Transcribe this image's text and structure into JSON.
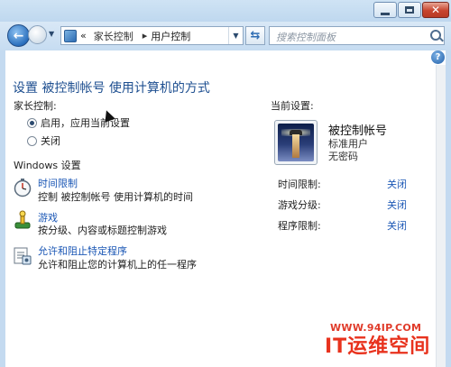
{
  "navigation": {
    "breadcrumb_prefix": "«",
    "breadcrumb": [
      "家长控制",
      "用户控制"
    ],
    "breadcrumb_separator": "▸",
    "search_placeholder": "搜索控制面板"
  },
  "help": {
    "label": "?"
  },
  "main": {
    "heading": "设置 被控制帐号 使用计算机的方式",
    "parental_controls_label": "家长控制:",
    "options": [
      {
        "label": "启用，应用当前设置",
        "selected": true
      },
      {
        "label": "关闭",
        "selected": false
      }
    ],
    "windows_settings_label": "Windows 设置",
    "settings": [
      {
        "icon": "stopwatch-icon",
        "link": "时间限制",
        "description": "控制 被控制帐号 使用计算机的时间"
      },
      {
        "icon": "game-controller-icon",
        "link": "游戏",
        "description": "按分级、内容或标题控制游戏"
      },
      {
        "icon": "program-list-icon",
        "link": "允许和阻止特定程序",
        "description": "允许和阻止您的计算机上的任一程序"
      }
    ]
  },
  "current_settings": {
    "label": "当前设置:",
    "user_name": "被控制帐号",
    "account_type": "标准用户",
    "password_status": "无密码",
    "items": [
      {
        "label": "时间限制:",
        "value": "关闭"
      },
      {
        "label": "游戏分级:",
        "value": "关闭"
      },
      {
        "label": "程序限制:",
        "value": "关闭"
      }
    ]
  },
  "watermark": {
    "url": "WWW.94IP.COM",
    "title": "IT运维空间"
  },
  "colors": {
    "link": "#1b57b5",
    "heading": "#1e4f90",
    "frame": "#c4daf0",
    "watermark": "#e8321d"
  }
}
